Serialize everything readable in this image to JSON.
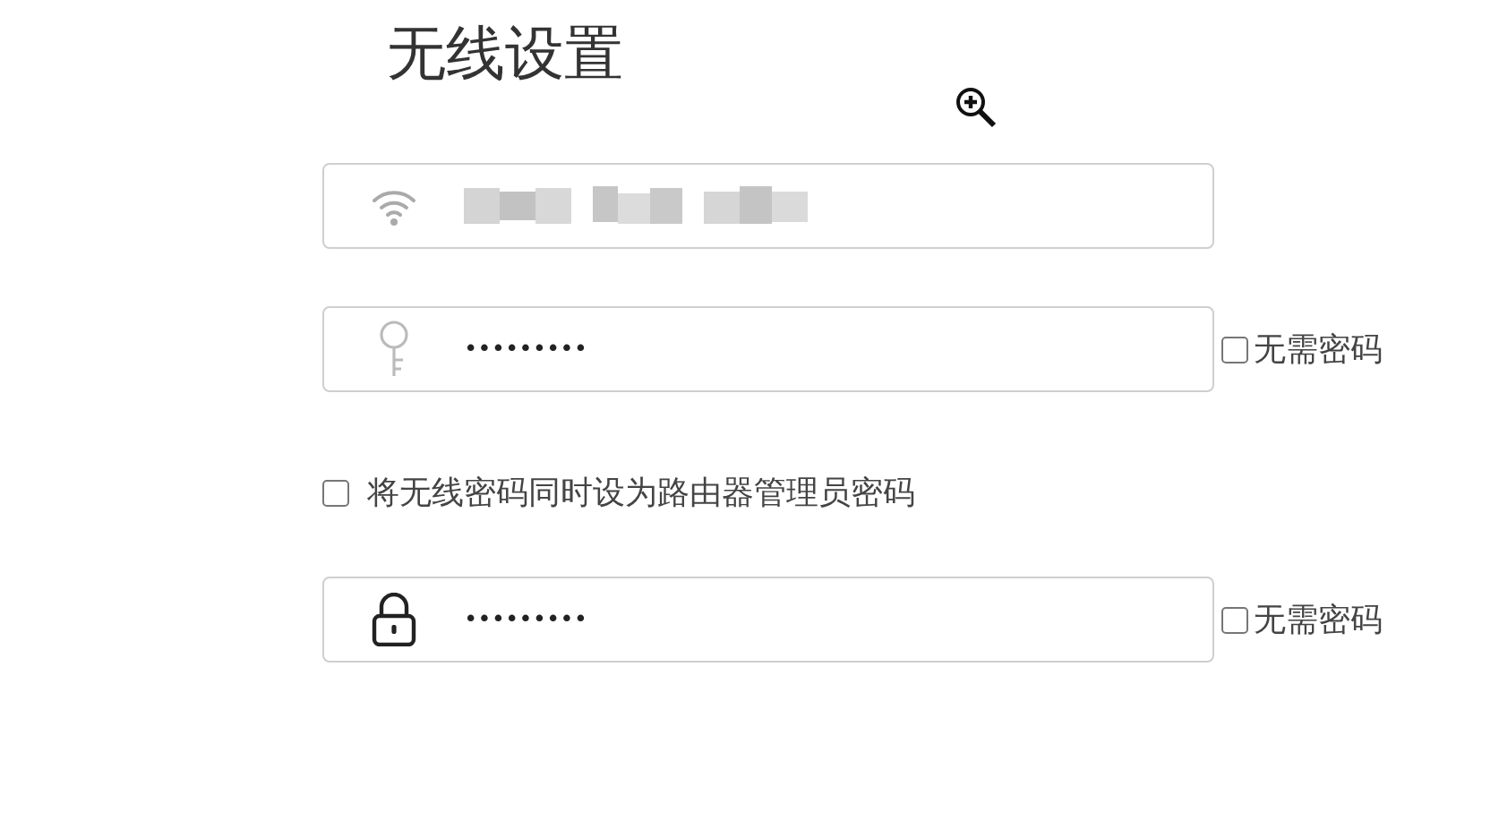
{
  "title": "无线设置",
  "fields": [
    {
      "kind": "wifi",
      "redacted": true
    },
    {
      "kind": "key",
      "value": "•••••••••",
      "no_password": {
        "label": "无需密码",
        "checked": false
      }
    },
    {
      "kind": "option",
      "label": "将无线密码同时设为路由器管理员密码",
      "checked": false
    },
    {
      "kind": "lock",
      "value": "•••••••••",
      "no_password": {
        "label": "无需密码",
        "checked": false
      }
    }
  ]
}
